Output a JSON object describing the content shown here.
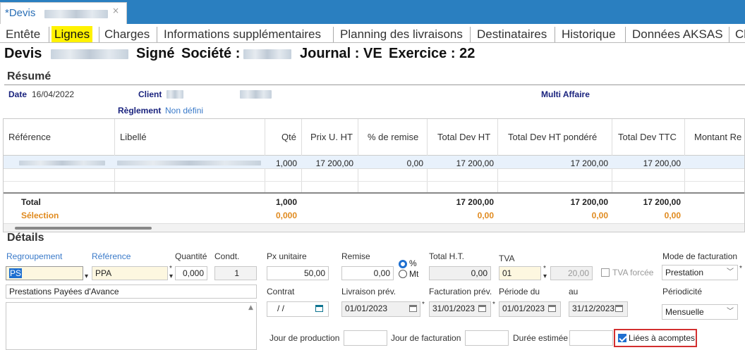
{
  "window": {
    "tab_title": "*Devis",
    "close_glyph": "×"
  },
  "tabs": [
    {
      "label": "Entête"
    },
    {
      "label": "Lignes",
      "active": true
    },
    {
      "label": "Charges"
    },
    {
      "label": "Informations supplémentaires"
    },
    {
      "label": "Planning des livraisons"
    },
    {
      "label": "Destinataires"
    },
    {
      "label": "Historique"
    },
    {
      "label": "Données AKSAS"
    },
    {
      "label": "Cl"
    }
  ],
  "heading": {
    "devis": "Devis",
    "signe": "Signé",
    "societe": "Société :",
    "journal": "Journal : VE",
    "exercice": "Exercice : 22"
  },
  "resume": {
    "title": "Résumé",
    "date_label": "Date",
    "date_value": "16/04/2022",
    "client_label": "Client",
    "multi_affaire": "Multi Affaire",
    "reglement_label": "Règlement",
    "reglement_value": "Non défini"
  },
  "grid": {
    "columns": [
      "Référence",
      "Libellé",
      "Qté",
      "Prix U. HT",
      "% de remise",
      "Total Dev HT",
      "Total Dev HT pondéré",
      "Total Dev TTC",
      "Montant Re"
    ],
    "row": {
      "qte": "1,000",
      "prix": "17 200,00",
      "remise": "0,00",
      "total_ht": "17 200,00",
      "total_pondere": "17 200,00",
      "total_ttc": "17 200,00"
    },
    "total": {
      "label": "Total",
      "qte": "1,000",
      "total_ht": "17 200,00",
      "total_pondere": "17 200,00",
      "total_ttc": "17 200,00"
    },
    "selection": {
      "label": "Sélection",
      "qte": "0,000",
      "total_ht": "0,00",
      "total_pondere": "0,00",
      "total_ttc": "0,00"
    }
  },
  "details": {
    "title": "Détails",
    "regroupement_label": "Regroupement",
    "regroupement_value": "PS",
    "reference_label": "Référence",
    "reference_value": "PPA",
    "quantite_label": "Quantité",
    "quantite_value": "0,000",
    "condt_label": "Condt.",
    "condt_value": "1",
    "libelle_value": "Prestations Payées d'Avance",
    "px_unitaire_label": "Px unitaire",
    "px_unitaire_value": "50,00",
    "remise_label": "Remise",
    "remise_value": "0,00",
    "pct_label": "%",
    "mt_label": "Mt",
    "total_ht_label": "Total H.T.",
    "total_ht_value": "0,00",
    "tva_label": "TVA",
    "tva_code": "01",
    "tva_rate": "20,00",
    "tva_forcee_label": "TVA forcée",
    "mode_facturation_label": "Mode de facturation",
    "mode_facturation_value": "Prestation",
    "contrat_label": "Contrat",
    "contrat_value": "/   /",
    "livraison_label": "Livraison prév.",
    "livraison_value": "01/01/2023",
    "facturation_label": "Facturation prév.",
    "facturation_value": "31/01/2023",
    "periode_du_label": "Période du",
    "periode_du_value": "01/01/2023",
    "au_label": "au",
    "au_value": "31/12/2023",
    "periodicite_label": "Périodicité",
    "periodicite_value": "Mensuelle",
    "jour_production_label": "Jour de production",
    "jour_facturation_label": "Jour de facturation",
    "duree_estimee_label": "Durée estimée",
    "liees_acomptes_label": "Liées à acomptes"
  }
}
